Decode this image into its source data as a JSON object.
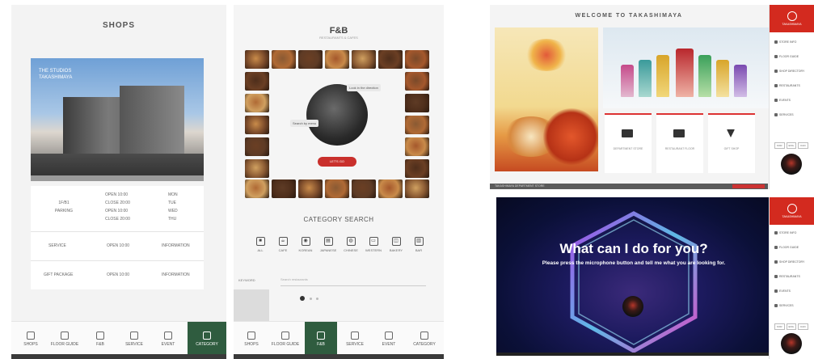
{
  "floor_guide": {
    "title": "SHOPS",
    "photo_caption_line1": "THE STUDIOS",
    "photo_caption_line2": "TAKASHIMAYA",
    "info_rows": [
      {
        "label": "1F/B1",
        "sub": "PARKING",
        "a": [
          "OPEN 10:00",
          "CLOSE 20:00",
          "OPEN 10:00",
          "CLOSE 20:00"
        ],
        "b": [
          "MON",
          "TUE",
          "WED",
          "THU"
        ]
      },
      {
        "label": "SERVICE",
        "a": [
          "OPEN 10:00"
        ],
        "b": [
          "INFORMATION"
        ]
      },
      {
        "label": "GIFT PACKAGE",
        "a": [
          "OPEN 10:00"
        ],
        "b": [
          "INFORMATION"
        ]
      }
    ]
  },
  "food_page": {
    "title": "F&B",
    "subtitle": "RESTAURANTS & CAFES",
    "callout_top": "Look in the direction",
    "callout_left": "Search by menu",
    "cta": "LET'S GO",
    "category_title": "CATEGORY SEARCH",
    "categories": [
      "ALL",
      "CAFE",
      "KOREAN",
      "JAPANESE",
      "CHINESE",
      "WESTERN",
      "BAKERY",
      "BAR"
    ],
    "search_label": "KEYWORD",
    "search_placeholder": "Search restaurants"
  },
  "tab_bar": {
    "panel1_tabs": [
      "SHOPS",
      "FLOOR GUIDE",
      "F&B",
      "SERVICE",
      "EVENT",
      "CATEGORY"
    ],
    "panel2_tabs": [
      "SHOPS",
      "FLOOR GUIDE",
      "F&B",
      "SERVICE",
      "EVENT",
      "CATEGORY"
    ]
  },
  "welcome": {
    "title": "WELCOME TO TAKASHIMAYA",
    "mini_cards": [
      "DEPARTMENT STORE",
      "RESTAURANT FLOOR",
      "GIFT SHOP"
    ],
    "footer_text": "TAKASHIMAYA DEPARTMENT STORE",
    "sidebar_brand": "TAKASHIMAYA",
    "sidebar_items": [
      "STORE INFO",
      "FLOOR GUIDE",
      "SHOP DIRECTORY",
      "RESTAURANTS",
      "EVENTS",
      "SERVICES"
    ],
    "languages": [
      "KOR",
      "ENG",
      "CHN"
    ]
  },
  "voice": {
    "heading": "What can I do for you?",
    "prompt": "Please press the microphone button and tell me what you are looking for.",
    "sidebar_brand": "TAKASHIMAYA",
    "sidebar_items": [
      "STORE INFO",
      "FLOOR GUIDE",
      "SHOP DIRECTORY",
      "RESTAURANTS",
      "EVENTS",
      "SERVICES"
    ],
    "languages": [
      "KOR",
      "ENG",
      "CHN"
    ]
  },
  "colors": {
    "brand_red": "#d32a1f",
    "nav_green": "#2f5c3f",
    "voice_bg": "#0b1038"
  }
}
